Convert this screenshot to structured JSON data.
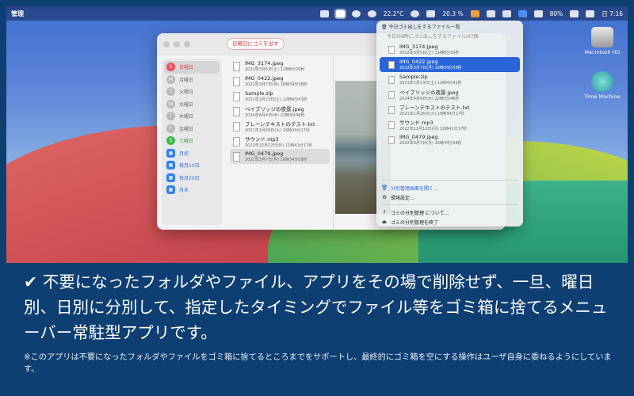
{
  "menubar": {
    "app": "管理",
    "weather": "22.2°C",
    "battery_pct": "20.3 %",
    "wifi_pct": "80%",
    "time": "日 7:16"
  },
  "desktop": [
    {
      "label": "Macintosh HD"
    },
    {
      "label": "Time Machine"
    }
  ],
  "window": {
    "trash_button": "日曜日にゴミを出す",
    "sidebar": [
      {
        "badge": "S",
        "label": "日曜日"
      },
      {
        "badge": "M",
        "label": "月曜日"
      },
      {
        "badge": "T",
        "label": "火曜日"
      },
      {
        "badge": "W",
        "label": "水曜日"
      },
      {
        "badge": "T",
        "label": "木曜日"
      },
      {
        "badge": "F",
        "label": "金曜日"
      },
      {
        "badge": "S",
        "label": "土曜日"
      },
      {
        "badge": "▦",
        "label": "月初"
      },
      {
        "badge": "▦",
        "label": "毎月10日"
      },
      {
        "badge": "▦",
        "label": "毎月20日"
      },
      {
        "badge": "▦",
        "label": "月末"
      }
    ],
    "files": [
      {
        "name": "IMG_3174.jpeg",
        "date": "2022年3月5日(土) 11時8分20秒"
      },
      {
        "name": "IMG_0422.jpeg",
        "date": "2022年3月7日(月) 16時34分58秒"
      },
      {
        "name": "Sample.zip",
        "date": "2021年1月23日(土) 12時4分41秒"
      },
      {
        "name": "ペイブリッジの夜景.jpeg",
        "date": "2024年4月4日(木) 22時3分46秒"
      },
      {
        "name": "プレーンテキストのテスト.txt",
        "date": "2021年1月26日(火) 16時34分17秒"
      },
      {
        "name": "サウンド.mp3",
        "date": "2022年12月12日(月) 11時41分17秒"
      },
      {
        "name": "IMG_0479.jpeg",
        "date": "2022年3月7日(月) 16時34分58秒"
      }
    ]
  },
  "menu": {
    "header": "今日ゴミ出しをするファイル一覧",
    "subheader": "今日の8時にゴミ出しをするファイルは7個",
    "files": [
      {
        "name": "IMG_3174.jpeg",
        "date": "2022年3月5日(土) 11時8分20秒"
      },
      {
        "name": "IMG_0422.jpeg",
        "date": "2022年3月7日(月) 16時34分58秒"
      },
      {
        "name": "Sample.zip",
        "date": "2021年1月23日(土) 12時4分41秒"
      },
      {
        "name": "ペイブリッジの夜景.jpeg",
        "date": "2024年4月4日(木) 22時3分46秒"
      },
      {
        "name": "プレーンテキストのテスト.txt",
        "date": "2021年1月26日(火) 16時34分17秒"
      },
      {
        "name": "サウンド.mp3",
        "date": "2022年12月12日(月) 11時41分17秒"
      },
      {
        "name": "IMG_0479.jpeg",
        "date": "2022年3月7日(月) 16時34分58秒"
      }
    ],
    "open_manager": "分別管理画面を開く…",
    "settings": "環境設定…",
    "about": "ゴミの分別管理 について…",
    "quit": "ゴミの分別管理を終了"
  },
  "caption": {
    "headline": "✔ 不要になったフォルダやファイル、アプリをその場で削除せず、一旦、曜日別、日別に分別して、指定したタイミングでファイル等をゴミ箱に捨てるメニューバー常駐型アプリです。",
    "note": "※このアプリは不要になったフォルダやファイルをゴミ箱に捨てるところまでをサポートし、最終的にゴミ箱を空にする操作はユーザ自身に委ねるようにしています。"
  }
}
